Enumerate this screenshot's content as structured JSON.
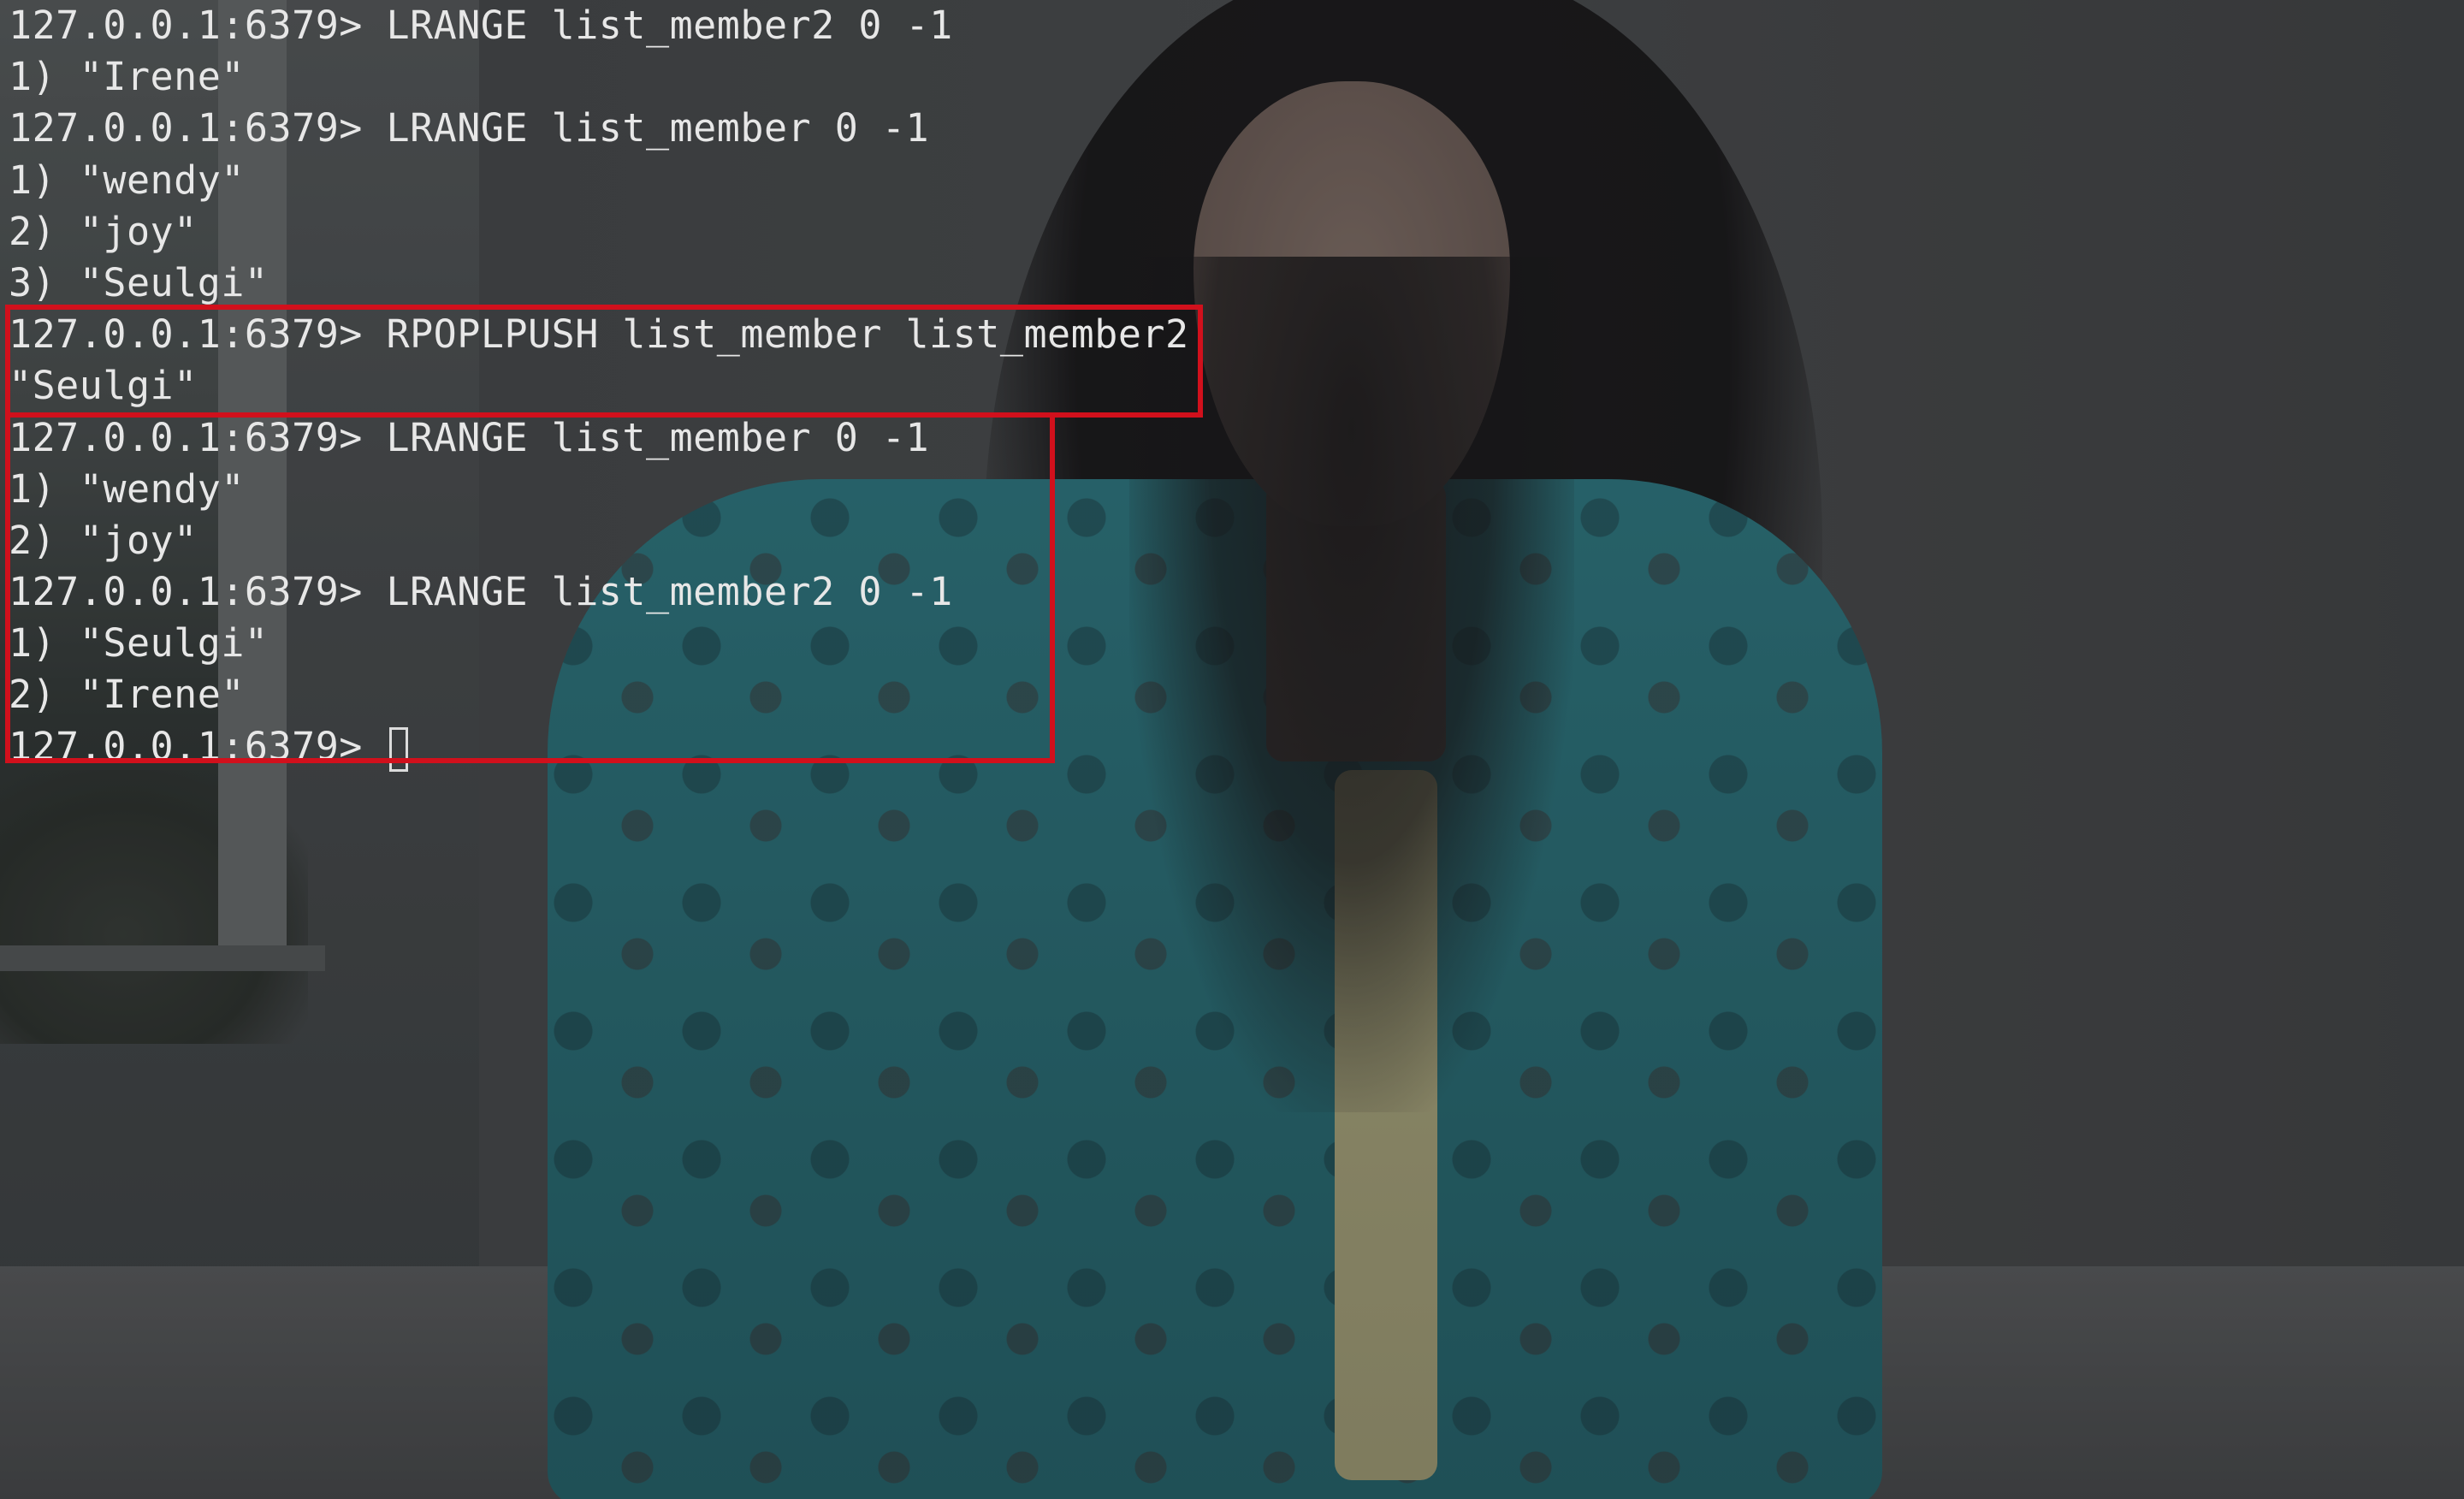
{
  "prompt": "127.0.0.1:6379>",
  "lines": [
    "127.0.0.1:6379> LRANGE list_member2 0 -1",
    "1) \"Irene\"",
    "127.0.0.1:6379> LRANGE list_member 0 -1",
    "1) \"wendy\"",
    "2) \"joy\"",
    "3) \"Seulgi\"",
    "127.0.0.1:6379> RPOPLPUSH list_member list_member2",
    "\"Seulgi\"",
    "127.0.0.1:6379> LRANGE list_member 0 -1",
    "1) \"wendy\"",
    "2) \"joy\"",
    "127.0.0.1:6379> LRANGE list_member2 0 -1",
    "1) \"Seulgi\"",
    "2) \"Irene\""
  ],
  "colors": {
    "text": "#e7e7e7",
    "highlight_border": "#d1101c"
  }
}
